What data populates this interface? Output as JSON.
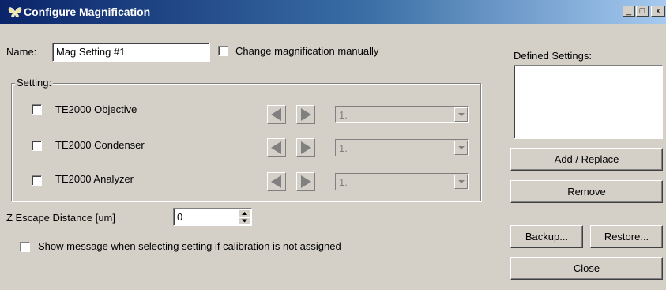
{
  "window": {
    "title": "Configure Magnification",
    "min_glyph": "_",
    "max_glyph": "□",
    "close_glyph": "x",
    "icon": "butterfly-app-icon"
  },
  "name_label": "Name:",
  "name_value": "Mag Setting #1",
  "change_manually_label": "Change magnification manually",
  "setting_group": {
    "label": "Setting:",
    "rows": [
      {
        "label": "TE2000 Objective",
        "value": "1."
      },
      {
        "label": "TE2000 Condenser",
        "value": "1."
      },
      {
        "label": "TE2000 Analyzer",
        "value": "1."
      }
    ]
  },
  "z_escape": {
    "label": "Z Escape Distance [um]",
    "value": "0"
  },
  "show_message_label": "Show message when selecting setting if calibration is not assigned",
  "defined_settings_label": "Defined Settings:",
  "buttons": {
    "add_replace": "Add / Replace",
    "remove": "Remove",
    "backup": "Backup...",
    "restore": "Restore...",
    "close": "Close"
  },
  "colors": {
    "titlebar_start": "#0a246a",
    "titlebar_end": "#a6caf0",
    "face": "#d4d0c8",
    "disabled_arrow": "#808080"
  }
}
